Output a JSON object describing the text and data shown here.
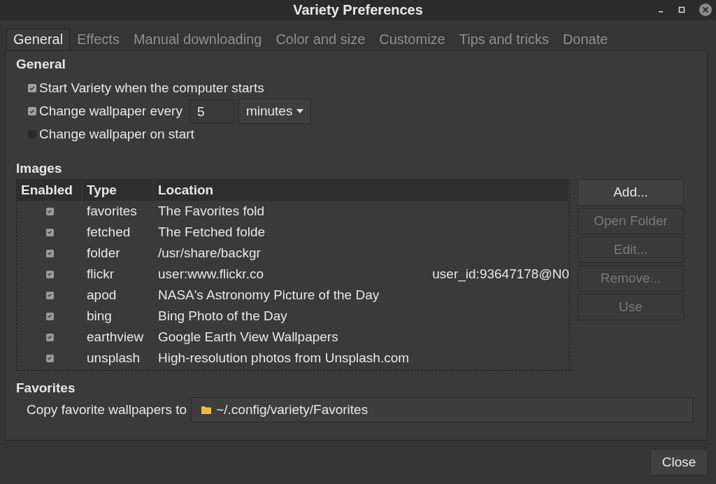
{
  "window": {
    "title": "Variety Preferences"
  },
  "tabs": [
    {
      "label": "General",
      "selected": true
    },
    {
      "label": "Effects",
      "selected": false
    },
    {
      "label": "Manual downloading",
      "selected": false
    },
    {
      "label": "Color and size",
      "selected": false
    },
    {
      "label": "Customize",
      "selected": false
    },
    {
      "label": "Tips and tricks",
      "selected": false
    },
    {
      "label": "Donate",
      "selected": false
    }
  ],
  "general": {
    "heading": "General",
    "options": [
      {
        "kind": "check",
        "label": "Start Variety when the computer starts",
        "checked": true
      },
      {
        "kind": "interval",
        "label": "Change wallpaper every",
        "checked": true,
        "value": "5",
        "unit": "minutes"
      },
      {
        "kind": "check",
        "label": "Change wallpaper on start",
        "checked": false
      }
    ]
  },
  "images": {
    "heading": "Images",
    "columns": [
      "Enabled",
      "Type",
      "Location"
    ],
    "rows": [
      {
        "enabled": true,
        "type": "favorites",
        "location": "The Favorites fold"
      },
      {
        "enabled": true,
        "type": "fetched",
        "location": "The Fetched folde"
      },
      {
        "enabled": true,
        "type": "folder",
        "location": "/usr/share/backgr"
      },
      {
        "enabled": true,
        "type": "flickr",
        "location": "user:www.flickr.co",
        "location_tail": "user_id:93647178@N0"
      },
      {
        "enabled": true,
        "type": "apod",
        "location": "NASA's Astronomy Picture of the Day"
      },
      {
        "enabled": true,
        "type": "bing",
        "location": "Bing Photo of the Day"
      },
      {
        "enabled": true,
        "type": "earthview",
        "location": "Google Earth View Wallpapers"
      },
      {
        "enabled": true,
        "type": "unsplash",
        "location": "High-resolution photos from Unsplash.com"
      }
    ],
    "buttons": [
      {
        "label": "Add...",
        "disabled": false
      },
      {
        "label": "Open Folder",
        "disabled": true
      },
      {
        "label": "Edit...",
        "disabled": true
      },
      {
        "label": "Remove...",
        "disabled": true
      },
      {
        "label": "Use",
        "disabled": true
      }
    ]
  },
  "favorites": {
    "heading": "Favorites",
    "label": "Copy favorite wallpapers to",
    "path": "~/.config/variety/Favorites"
  },
  "close_button": "Close"
}
